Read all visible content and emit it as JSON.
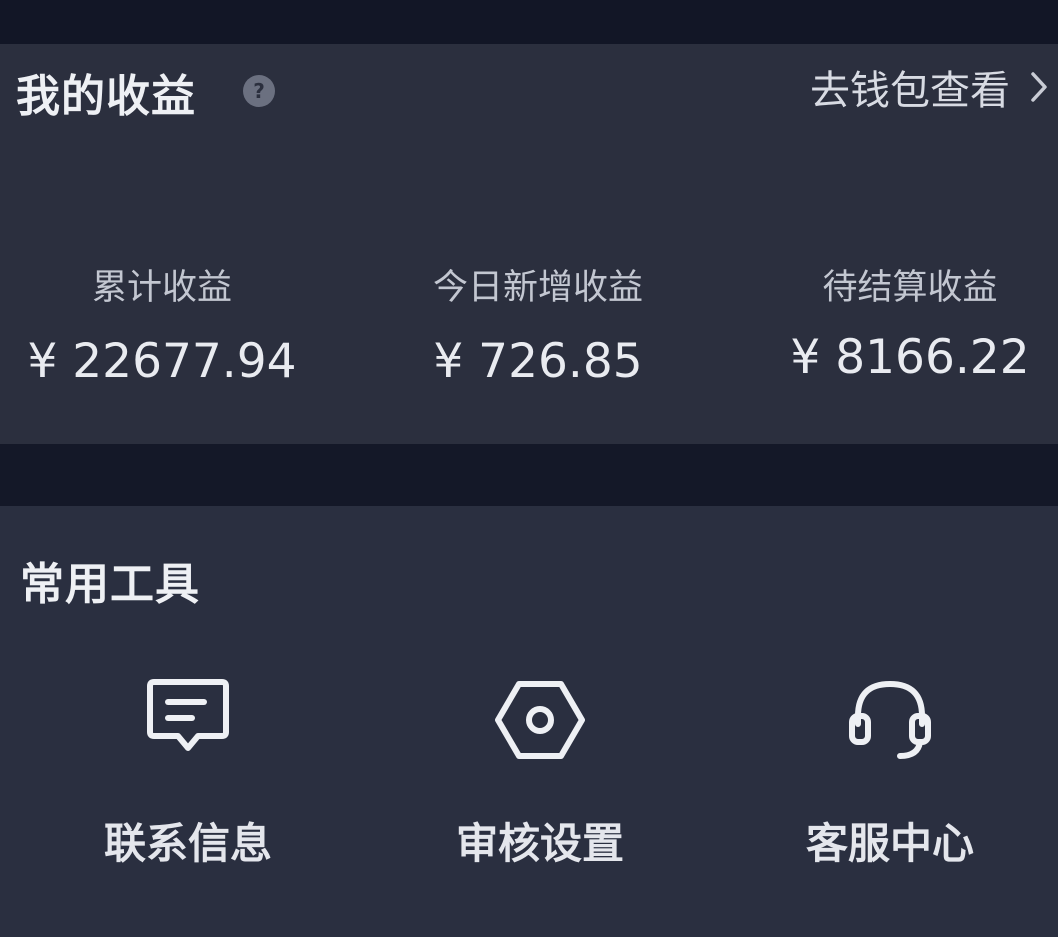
{
  "earnings": {
    "title": "我的收益",
    "help_icon": "question-circle-icon",
    "wallet_link": "去钱包查看",
    "chevron_icon": "chevron-right-icon",
    "stats": [
      {
        "label": "累计收益",
        "value": "¥ 22677.94"
      },
      {
        "label": "今日新增收益",
        "value": "¥ 726.85"
      },
      {
        "label": "待结算收益",
        "value": "¥ 8166.22"
      }
    ]
  },
  "tools": {
    "title": "常用工具",
    "items": [
      {
        "label": "联系信息",
        "icon": "message-icon"
      },
      {
        "label": "审核设置",
        "icon": "hexagon-settings-icon"
      },
      {
        "label": "客服中心",
        "icon": "headset-icon"
      }
    ]
  },
  "colors": {
    "background": "#131726",
    "card": "#2b2f3e",
    "text": "#e6e8ee",
    "muted": "#c3c7d1"
  }
}
